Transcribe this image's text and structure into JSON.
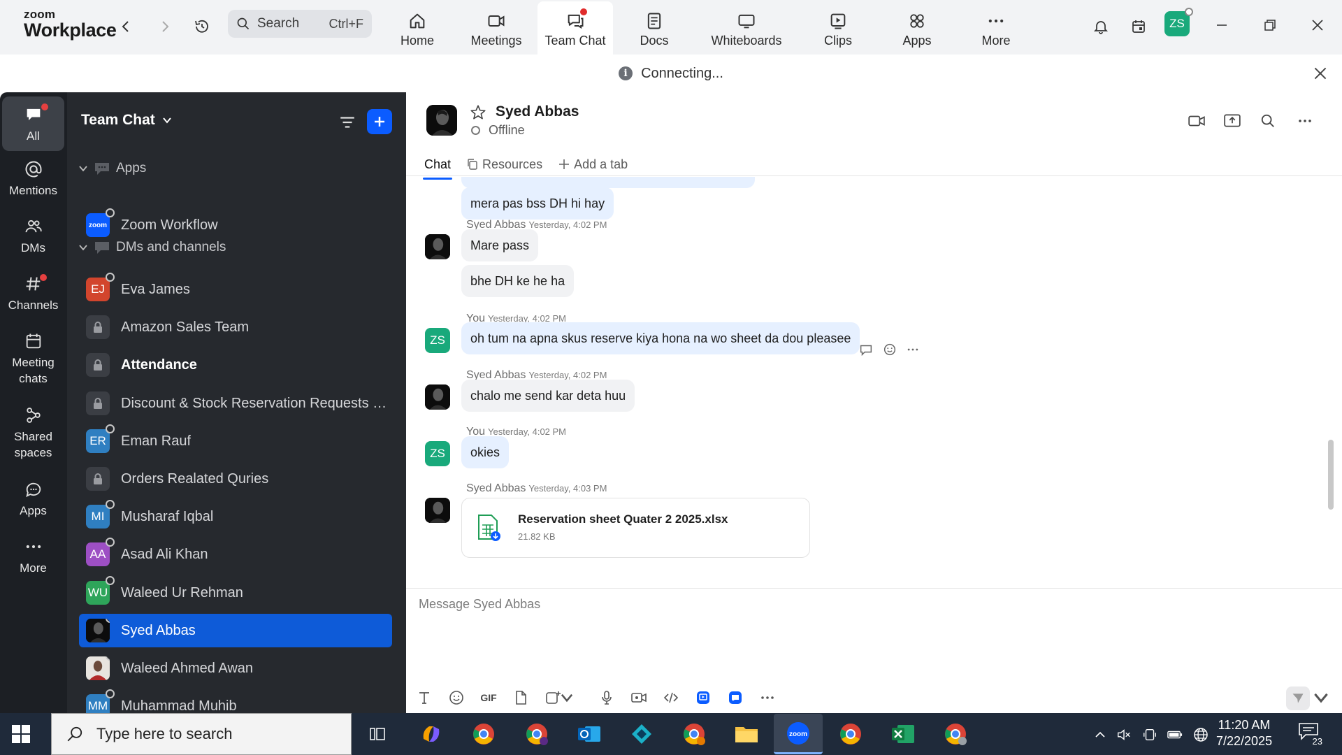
{
  "app": {
    "logo_line1": "zoom",
    "logo_line2": "Workplace",
    "search_placeholder": "Search",
    "search_shortcut": "Ctrl+F",
    "nav": [
      {
        "label": "Home",
        "icon": "home-icon"
      },
      {
        "label": "Meetings",
        "icon": "video-camera-icon"
      },
      {
        "label": "Team Chat",
        "icon": "chat-icon",
        "active": true
      },
      {
        "label": "Docs",
        "icon": "document-icon"
      },
      {
        "label": "Whiteboards",
        "icon": "whiteboard-icon"
      },
      {
        "label": "Clips",
        "icon": "clips-icon"
      },
      {
        "label": "Apps",
        "icon": "apps-icon"
      },
      {
        "label": "More",
        "icon": "more-dots-icon"
      }
    ],
    "user_initials": "ZS",
    "accent": "#0b5cff"
  },
  "banner": {
    "text": "Connecting..."
  },
  "rail": [
    {
      "label": "All",
      "icon": "chat-bubble-icon"
    },
    {
      "label": "Mentions",
      "icon": "at-icon"
    },
    {
      "label": "DMs",
      "icon": "people-icon"
    },
    {
      "label": "Channels",
      "icon": "hash-icon"
    },
    {
      "label": "Meeting chats",
      "icon": "calendar-icon"
    },
    {
      "label": "Shared spaces",
      "icon": "shared-spaces-icon"
    },
    {
      "label": "Apps",
      "icon": "apps-chat-icon"
    },
    {
      "label": "More",
      "icon": "more-dots-icon"
    }
  ],
  "panel": {
    "title": "Team Chat",
    "sections": {
      "apps": "Apps",
      "dms": "DMs and channels"
    },
    "apps_items": [
      {
        "name": "Zoom Workflow",
        "badge": "zoom"
      }
    ],
    "items": [
      {
        "name": "Eva James",
        "initials": "EJ",
        "color": "#d2452d",
        "type": "avatar"
      },
      {
        "name": "Amazon Sales Team",
        "type": "lock"
      },
      {
        "name": "Attendance",
        "type": "lock",
        "bold": true
      },
      {
        "name": "Discount & Stock Reservation Requests O...",
        "type": "lock"
      },
      {
        "name": "Eman Rauf",
        "initials": "ER",
        "color": "#2f7fc1",
        "type": "avatar"
      },
      {
        "name": "Orders Realated Quries",
        "type": "lock"
      },
      {
        "name": "Musharaf Iqbal",
        "initials": "MI",
        "color": "#2f7fc1",
        "type": "avatar"
      },
      {
        "name": "Asad Ali Khan",
        "initials": "AA",
        "color": "#9d4fc4",
        "type": "avatar"
      },
      {
        "name": "Waleed Ur Rehman",
        "initials": "WU",
        "color": "#2ea55a",
        "type": "avatar"
      },
      {
        "name": "Syed Abbas",
        "type": "photo",
        "selected": true
      },
      {
        "name": "Waleed Ahmed Awan",
        "type": "photo2"
      },
      {
        "name": "Muhammad Muhib",
        "initials": "MM",
        "color": "#2f7fc1",
        "type": "avatar"
      }
    ]
  },
  "chat": {
    "contact_name": "Syed Abbas",
    "contact_status": "Offline",
    "tabs": [
      "Chat",
      "Resources",
      "Add a tab"
    ],
    "messages": [
      {
        "text": "mera pas bss DH hi hay"
      },
      {
        "sender": "Syed Abbas",
        "time": "Yesterday, 4:02 PM"
      },
      {
        "text": "Mare pass"
      },
      {
        "text": "bhe DH ke he ha"
      },
      {
        "sender": "You",
        "time": "Yesterday, 4:02 PM"
      },
      {
        "text": "oh tum na apna skus reserve kiya hona na wo sheet da dou pleasee"
      },
      {
        "sender": "Syed Abbas",
        "time": "Yesterday, 4:02 PM"
      },
      {
        "text": "chalo me send kar deta huu"
      },
      {
        "sender": "You",
        "time": "Yesterday, 4:02 PM"
      },
      {
        "text": "okies"
      },
      {
        "sender": "Syed Abbas",
        "time": "Yesterday, 4:03 PM"
      }
    ],
    "file": {
      "name": "Reservation sheet Quater 2 2025.xlsx",
      "size": "21.82 KB"
    },
    "composer_placeholder": "Message Syed Abbas",
    "gif_label": "GIF"
  },
  "taskbar": {
    "search_placeholder": "Type here to search",
    "time": "11:20 AM",
    "date": "7/22/2025",
    "notifications": "23"
  }
}
